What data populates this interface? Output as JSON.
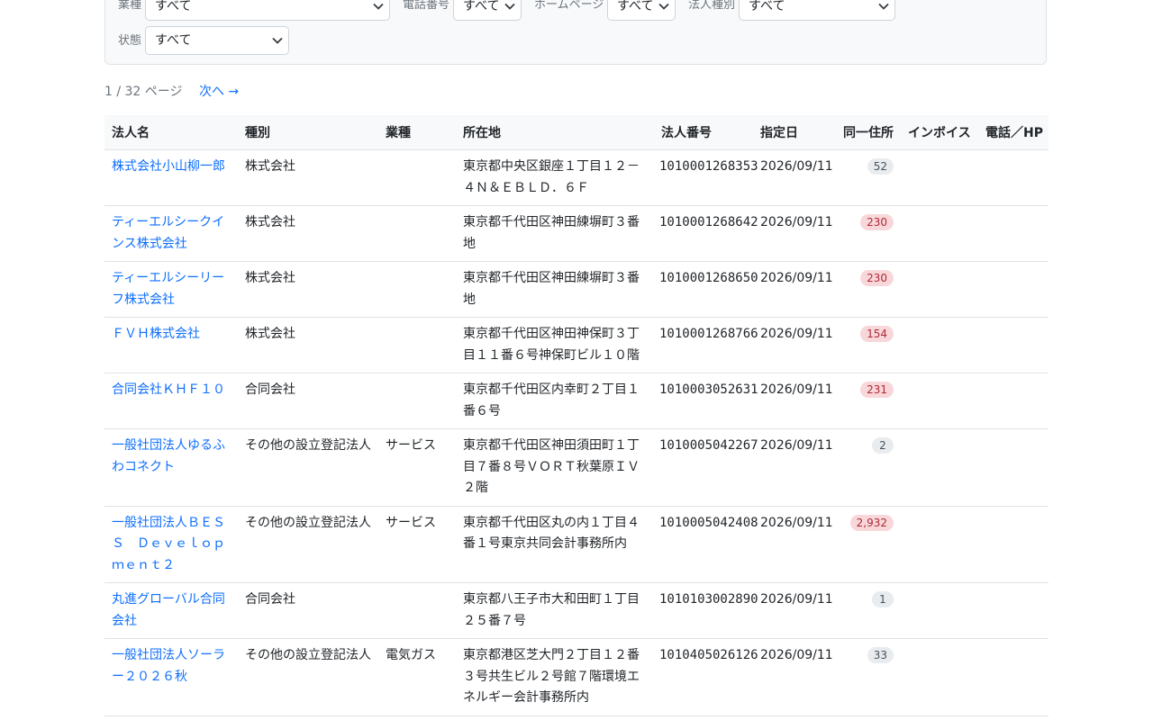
{
  "filters": {
    "industry": {
      "label": "業種",
      "value": "すべて"
    },
    "phone": {
      "label": "電話番号",
      "value": "すべて"
    },
    "homepage": {
      "label": "ホームページ",
      "value": "すべて"
    },
    "corp_type": {
      "label": "法人種別",
      "value": "すべて"
    },
    "status": {
      "label": "状態",
      "value": "すべて"
    }
  },
  "pager": {
    "info": "1 / 32 ページ",
    "next": "次へ →"
  },
  "table": {
    "headers": [
      "法人名",
      "種別",
      "業種",
      "所在地",
      "法人番号",
      "指定日",
      "同一住所",
      "インボイス",
      "電話／HP"
    ],
    "rows": [
      {
        "name": "株式会社小山柳一郎",
        "kind": "株式会社",
        "industry": "",
        "address": "東京都中央区銀座１丁目１２－４Ｎ＆ＥＢＬＤ．６Ｆ",
        "number": "1010001268353",
        "date": "2026/09/11",
        "same": "52",
        "level": "low"
      },
      {
        "name": "ティーエルシークインス株式会社",
        "kind": "株式会社",
        "industry": "",
        "address": "東京都千代田区神田練塀町３番地",
        "number": "1010001268642",
        "date": "2026/09/11",
        "same": "230",
        "level": "high"
      },
      {
        "name": "ティーエルシーリーフ株式会社",
        "kind": "株式会社",
        "industry": "",
        "address": "東京都千代田区神田練塀町３番地",
        "number": "1010001268650",
        "date": "2026/09/11",
        "same": "230",
        "level": "high"
      },
      {
        "name": "ＦＶＨ株式会社",
        "kind": "株式会社",
        "industry": "",
        "address": "東京都千代田区神田神保町３丁目１１番６号神保町ビル１０階",
        "number": "1010001268766",
        "date": "2026/09/11",
        "same": "154",
        "level": "high"
      },
      {
        "name": "合同会社ＫＨＦ１０",
        "kind": "合同会社",
        "industry": "",
        "address": "東京都千代田区内幸町２丁目１番６号",
        "number": "1010003052631",
        "date": "2026/09/11",
        "same": "231",
        "level": "high"
      },
      {
        "name": "一般社団法人ゆるふわコネクト",
        "kind": "その他の設立登記法人",
        "industry": "サービス",
        "address": "東京都千代田区神田須田町１丁目７番８号ＶＯＲＴ秋葉原ＩＶ２階",
        "number": "1010005042267",
        "date": "2026/09/11",
        "same": "2",
        "level": "low"
      },
      {
        "name": "一般社団法人ＢＥＳＳ　Ｄｅｖｅｌｏｐｍｅｎｔ２",
        "kind": "その他の設立登記法人",
        "industry": "サービス",
        "address": "東京都千代田区丸の内１丁目４番１号東京共同会計事務所内",
        "number": "1010005042408",
        "date": "2026/09/11",
        "same": "2,932",
        "level": "high"
      },
      {
        "name": "丸進グローバル合同会社",
        "kind": "合同会社",
        "industry": "",
        "address": "東京都八王子市大和田町１丁目２５番７号",
        "number": "1010103002890",
        "date": "2026/09/11",
        "same": "1",
        "level": "low"
      },
      {
        "name": "一般社団法人ソーラー２０２６秋",
        "kind": "その他の設立登記法人",
        "industry": "電気ガス",
        "address": "東京都港区芝大門２丁目１２番３号共生ビル２号館７階環境エネルギー会計事務所内",
        "number": "1010405026126",
        "date": "2026/09/11",
        "same": "33",
        "level": "low"
      }
    ]
  }
}
